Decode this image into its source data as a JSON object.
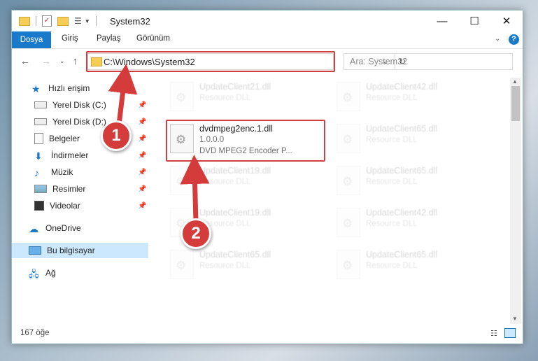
{
  "titlebar": {
    "title": "System32"
  },
  "ribbon": {
    "tabs": [
      "Dosya",
      "Giriş",
      "Paylaş",
      "Görünüm"
    ]
  },
  "address": {
    "path": "C:\\Windows\\System32"
  },
  "search": {
    "placeholder": "Ara: System32"
  },
  "sidebar": {
    "quick_access": "Hızlı erişim",
    "items": [
      "Yerel Disk (C:)",
      "Yerel Disk (D:)",
      "Belgeler",
      "İndirmeler",
      "Müzik",
      "Resimler",
      "Videolar"
    ],
    "onedrive": "OneDrive",
    "this_pc": "Bu bilgisayar",
    "network": "Ağ"
  },
  "files": {
    "highlighted": {
      "name": "dvdmpeg2enc.1.dll",
      "version": "1.0.0.0",
      "description": "DVD MPEG2 Encoder P..."
    },
    "background": [
      {
        "name": "UpdateClient21.dll",
        "desc": "Resource DLL"
      },
      {
        "name": "UpdateClient42.dll",
        "desc": "Resource DLL"
      },
      {
        "name": "UpdateClient65.dll",
        "desc": "Resource DLL"
      },
      {
        "name": "UpdateClient19.dll",
        "desc": "Resource DLL"
      },
      {
        "name": "UpdateClient65.dll",
        "desc": "Resource DLL"
      },
      {
        "name": "UpdateClient19.dll",
        "desc": "Resource DLL"
      },
      {
        "name": "UpdateClient42.dll",
        "desc": "Resource DLL"
      },
      {
        "name": "UpdateClient65.dll",
        "desc": "Resource DLL"
      },
      {
        "name": "UpdateClient65.dll",
        "desc": "Resource DLL"
      }
    ]
  },
  "status": {
    "count": "167 öğe"
  },
  "callouts": [
    "1",
    "2"
  ],
  "colors": {
    "accent": "#1979ca",
    "highlight": "#d04040",
    "selected": "#cce8ff"
  }
}
